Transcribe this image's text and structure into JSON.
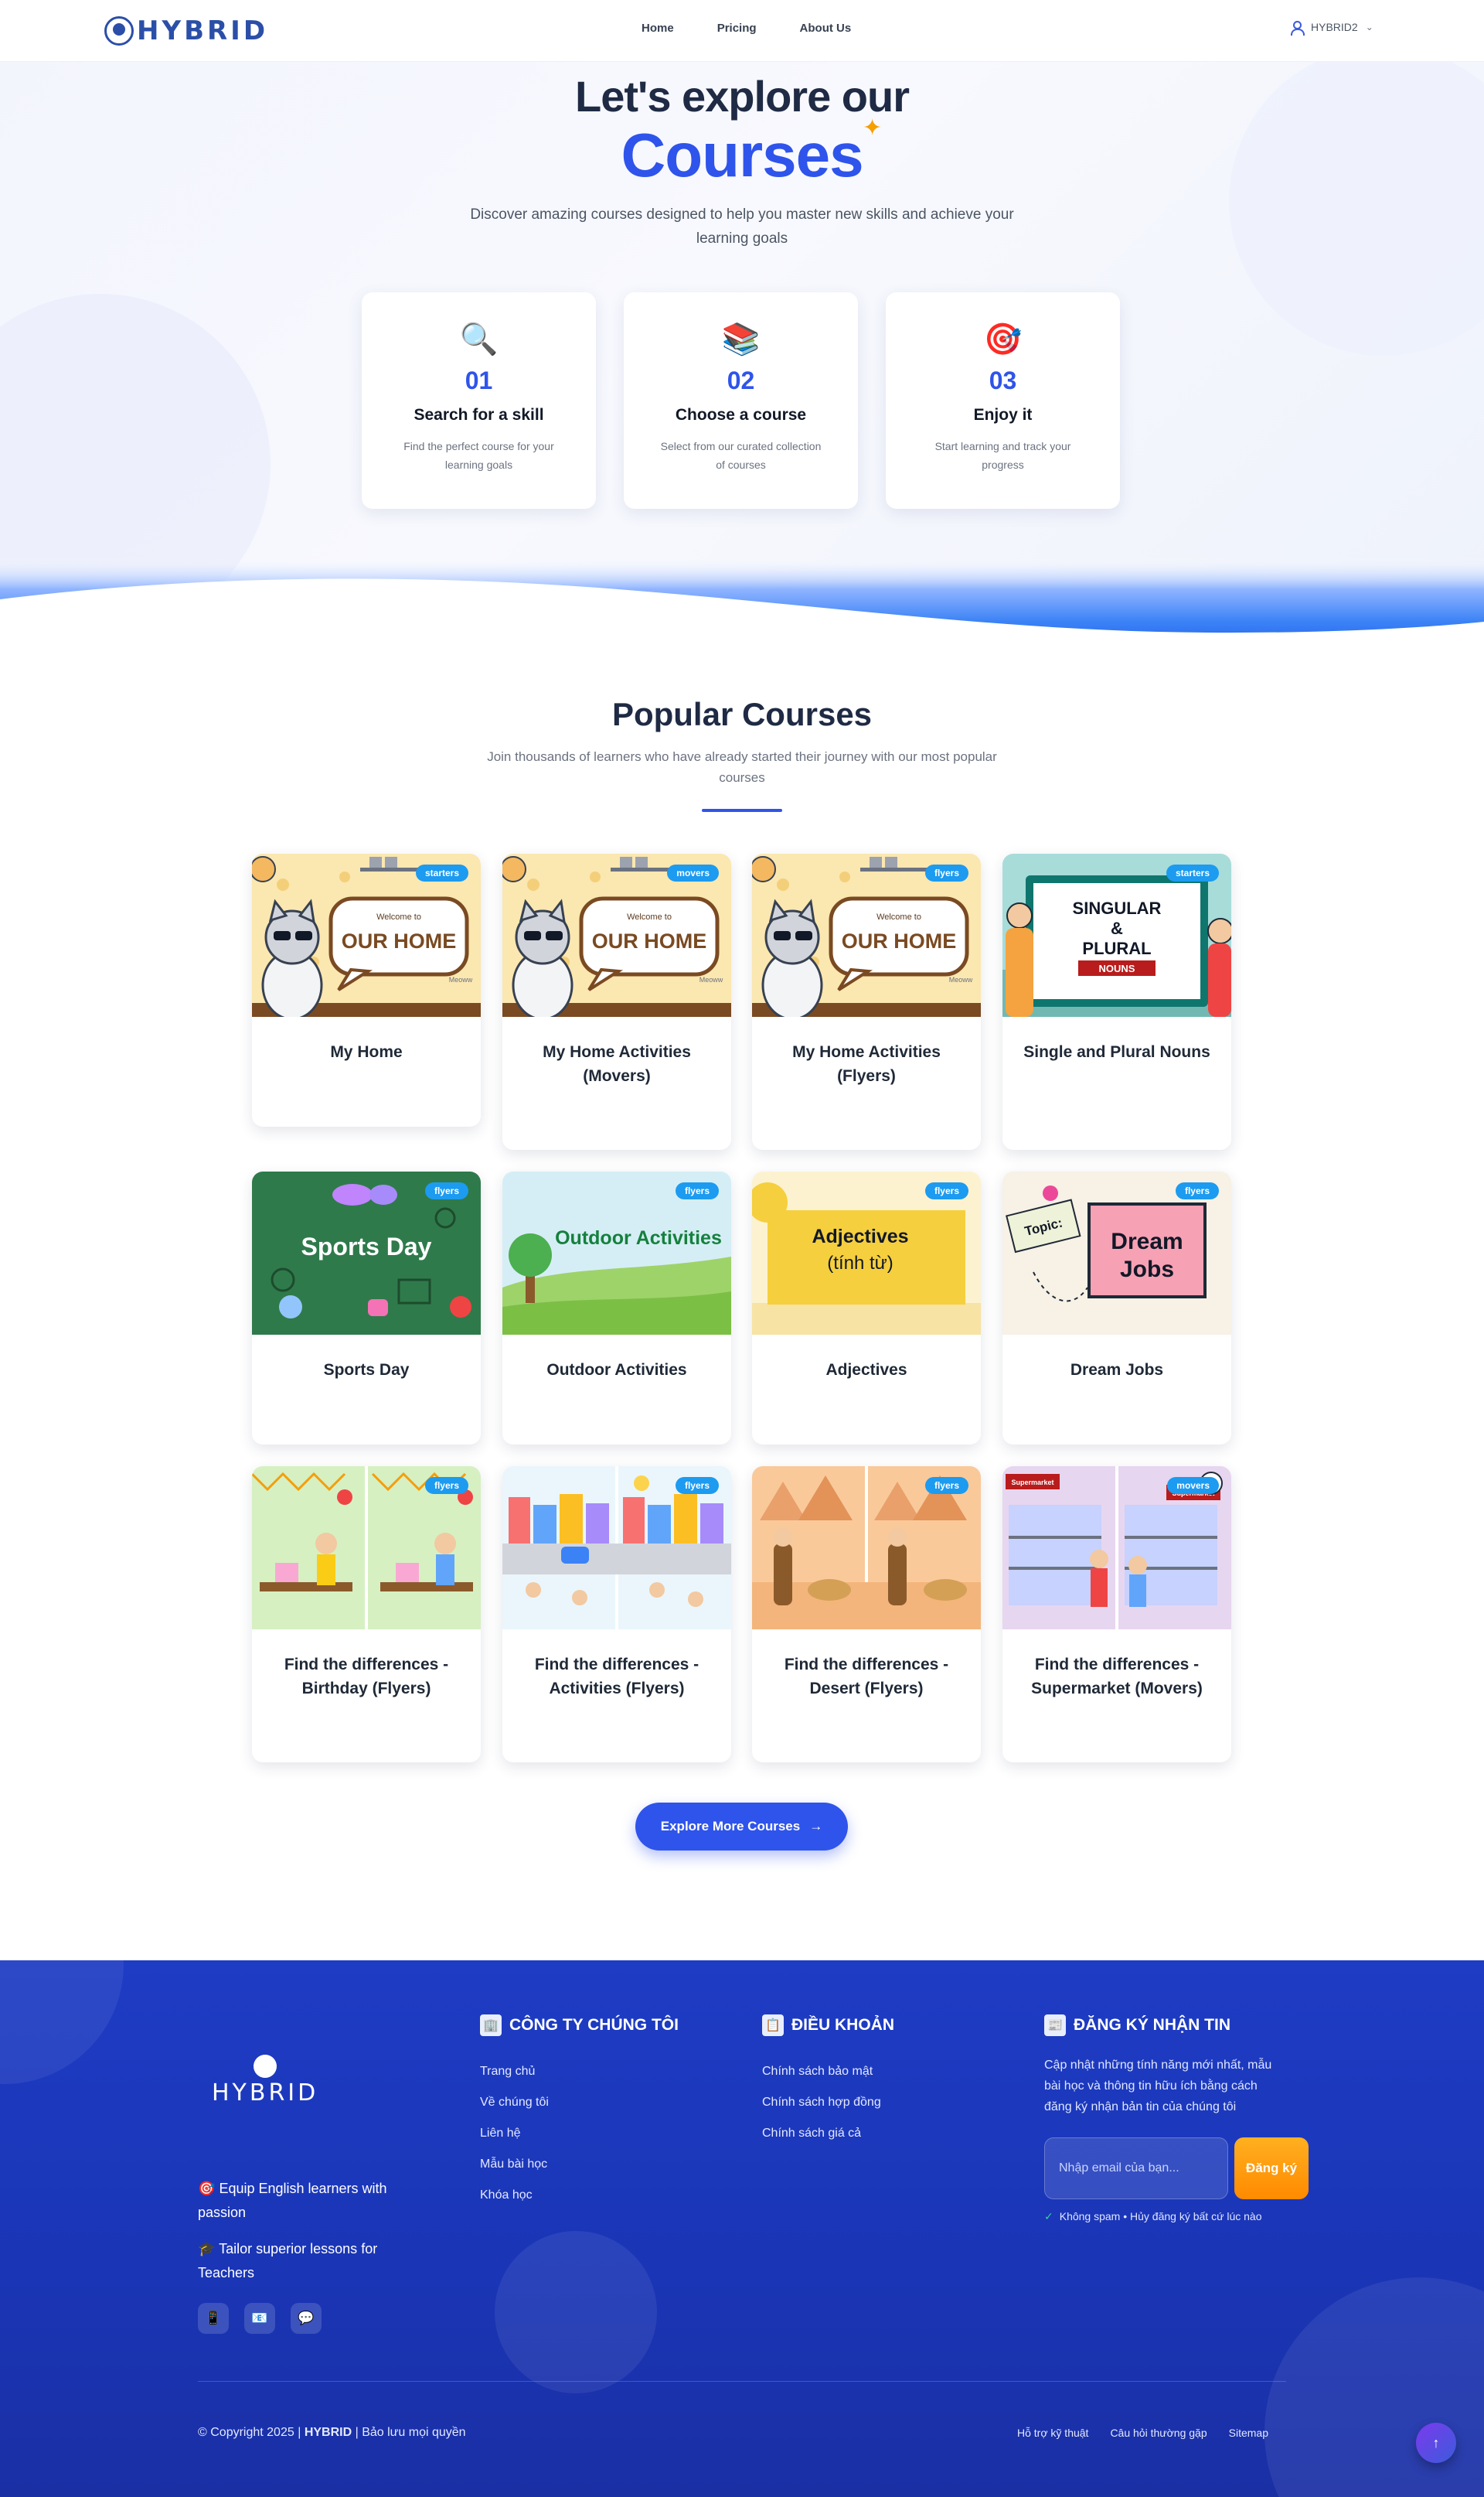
{
  "nav": {
    "logo_text": "HYBRID",
    "links": [
      "Home",
      "Pricing",
      "About Us"
    ],
    "user_label": "HYBRID2"
  },
  "hero": {
    "title_line1": "Let's explore our",
    "title_line2": "Courses",
    "subtitle": "Discover amazing courses designed to help you master new skills and achieve your learning goals",
    "steps": [
      {
        "icon": "magnifier-icon",
        "number": "01",
        "title": "Search for a skill",
        "description": "Find the perfect course for your learning goals"
      },
      {
        "icon": "books-icon",
        "number": "02",
        "title": "Choose a course",
        "description": "Select from our curated collection of courses"
      },
      {
        "icon": "target-icon",
        "number": "03",
        "title": "Enjoy it",
        "description": "Start learning and track your progress"
      }
    ]
  },
  "popular": {
    "title": "Popular Courses",
    "subtitle": "Join thousands of learners who have already started their journey with our most popular courses",
    "courses": [
      {
        "title": "My Home",
        "badge": "starters",
        "thumb": "home"
      },
      {
        "title": "My Home Activities (Movers)",
        "badge": "movers",
        "thumb": "home"
      },
      {
        "title": "My Home Activities (Flyers)",
        "badge": "flyers",
        "thumb": "home"
      },
      {
        "title": "Single and Plural Nouns",
        "badge": "starters",
        "thumb": "nouns"
      },
      {
        "title": "Sports Day",
        "badge": "flyers",
        "thumb": "sports"
      },
      {
        "title": "Outdoor Activities",
        "badge": "flyers",
        "thumb": "outdoor"
      },
      {
        "title": "Adjectives",
        "badge": "flyers",
        "thumb": "adjectives"
      },
      {
        "title": "Dream Jobs",
        "badge": "flyers",
        "thumb": "jobs"
      },
      {
        "title": "Find the differences - Birthday (Flyers)",
        "badge": "flyers",
        "thumb": "birthday"
      },
      {
        "title": "Find the differences - Activities (Flyers)",
        "badge": "flyers",
        "thumb": "town"
      },
      {
        "title": "Find the differences - Desert (Flyers)",
        "badge": "flyers",
        "thumb": "desert"
      },
      {
        "title": "Find the differences - Supermarket (Movers)",
        "badge": "movers",
        "thumb": "market"
      }
    ],
    "thumb_text": {
      "welcome": "Welcome to",
      "our_home": "OUR HOME",
      "meow": "Meoww",
      "singular": "SINGULAR",
      "amp": "&",
      "plural": "PLURAL",
      "nouns": "NOUNS",
      "sports": "Sports Day",
      "outdoor": "Outdoor Activities",
      "adjectives": "Adjectives",
      "tinh_tu": "(tính từ)",
      "topic": "Topic:",
      "dream": "Dream",
      "jobs": "Jobs",
      "supermarket": "Supermarket"
    },
    "explore_button": "Explore More Courses",
    "explore_arrow": "→"
  },
  "footer": {
    "logo_text": "HYBRID",
    "pitch": [
      {
        "icon": "🎯",
        "text": "Equip English learners with passion"
      },
      {
        "icon": "🎓",
        "text": "Tailor superior lessons for Teachers"
      }
    ],
    "socials": [
      {
        "icon": "📱",
        "name": "phone-icon"
      },
      {
        "icon": "📧",
        "name": "email-icon"
      },
      {
        "icon": "💬",
        "name": "chat-icon"
      }
    ],
    "company": {
      "icon": "🏢",
      "heading": "CÔNG TY CHÚNG TÔI",
      "links": [
        "Trang chủ",
        "Về chúng tôi",
        "Liên hệ",
        "Mẫu bài học",
        "Khóa học"
      ]
    },
    "terms": {
      "icon": "📋",
      "heading": "ĐIỀU KHOẢN",
      "links": [
        "Chính sách bảo mật",
        "Chính sách hợp đồng",
        "Chính sách giá cả"
      ]
    },
    "newsletter": {
      "icon": "📰",
      "heading": "ĐĂNG KÝ NHẬN TIN",
      "description": "Cập nhật những tính năng mới nhất, mẫu bài học và thông tin hữu ích bằng cách đăng ký nhận bản tin của chúng tôi",
      "input_placeholder": "Nhập email của bạn...",
      "button": "Đăng ký",
      "check": "✓",
      "note": "Không spam • Hủy đăng ký bất cứ lúc nào"
    },
    "copyright_prefix": "© Copyright 2025 |",
    "copyright_brand": "HYBRID",
    "copyright_suffix": "| Bảo lưu mọi quyền",
    "bottom_links": [
      "Hỗ trợ kỹ thuật",
      "Câu hỏi thường gặp",
      "Sitemap"
    ],
    "to_top": "↑"
  },
  "colors": {
    "accent": "#2f54eb",
    "footer_bg": "#1e3cc4",
    "badge": "#1c9bf0",
    "subscribe": "#ff9500"
  }
}
